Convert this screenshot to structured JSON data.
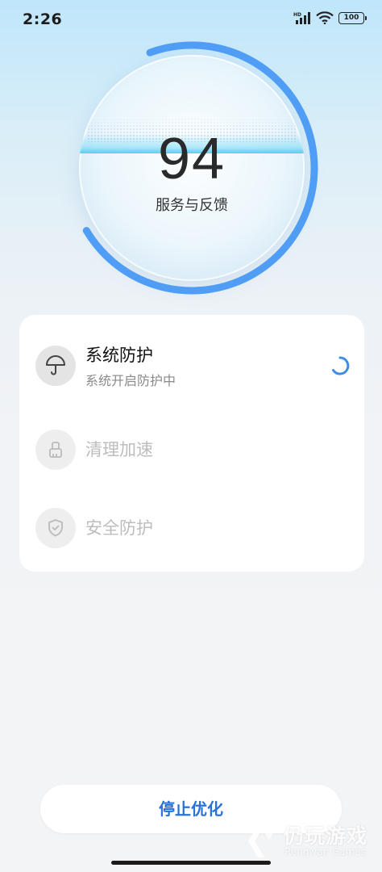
{
  "status_bar": {
    "time": "2:26",
    "network_label": "HD",
    "battery": "100"
  },
  "score": {
    "value": "94",
    "label": "服务与反馈",
    "progress": 0.72,
    "ring_color": "#4f9df5"
  },
  "tasks": [
    {
      "title": "系统防护",
      "subtitle": "系统开启防护中",
      "icon": "umbrella-icon",
      "state": "running"
    },
    {
      "title": "清理加速",
      "icon": "brush-icon",
      "state": "pending"
    },
    {
      "title": "安全防护",
      "icon": "shield-icon",
      "state": "pending"
    }
  ],
  "actions": {
    "stop_label": "停止优化",
    "accent_color": "#2a73d6"
  },
  "watermark": {
    "text": "仍玩游戏",
    "sub": "Rengwan Games"
  }
}
